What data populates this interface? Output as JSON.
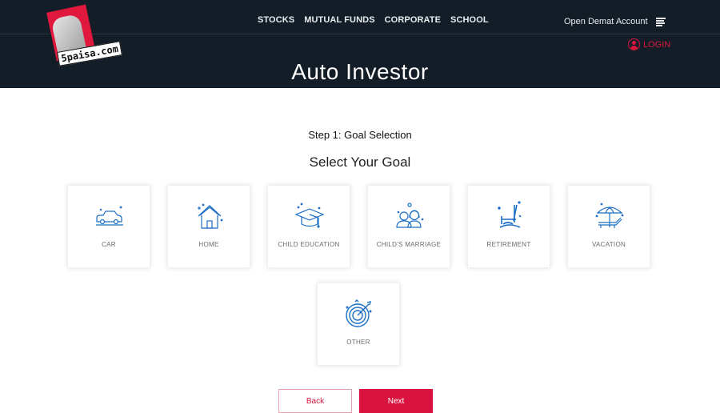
{
  "header": {
    "logo_text": "5paisa.com",
    "nav": [
      "STOCKS",
      "MUTUAL FUNDS",
      "CORPORATE",
      "SCHOOL"
    ],
    "open_demat": "Open Demat Account",
    "login": "LOGIN",
    "title": "Auto Investor"
  },
  "colors": {
    "header_bg": "#121d27",
    "accent_red": "#d8133f",
    "icon_blue": "#1c6fc4"
  },
  "main": {
    "step": "Step 1: Goal Selection",
    "subtitle": "Select Your Goal",
    "goals": [
      {
        "label": "CAR",
        "icon": "car-icon"
      },
      {
        "label": "HOME",
        "icon": "home-icon"
      },
      {
        "label": "CHILD EDUCATION",
        "icon": "graduation-cap-icon"
      },
      {
        "label": "CHILD'S MARRIAGE",
        "icon": "couple-icon"
      },
      {
        "label": "RETIREMENT",
        "icon": "rocking-chair-icon"
      },
      {
        "label": "VACATION",
        "icon": "beach-umbrella-icon"
      },
      {
        "label": "OTHER",
        "icon": "target-icon"
      }
    ]
  },
  "buttons": {
    "back": "Back",
    "next": "Next"
  }
}
